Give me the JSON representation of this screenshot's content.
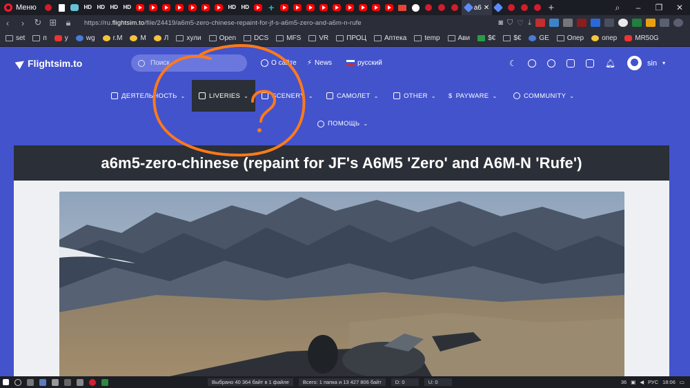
{
  "browser": {
    "menu_label": "Меню",
    "active_tab_title": "a6",
    "address_url_prefix": "https://ru.",
    "address_url_domain": "flightsim.to",
    "address_url_path": "/file/24419/a6m5-zero-chinese-repaint-for-jf-s-a6m5-zero-and-a6m-n-rufe",
    "hd_tab_label": "HD",
    "bookmarks": [
      "set",
      "п",
      "у",
      "wg",
      "r.M",
      "М",
      "Л",
      "хули",
      "Open",
      "DCS",
      "MFS",
      "VR",
      "ПРОЦ",
      "Аптека",
      "temp",
      "Ави",
      "$€",
      "$€",
      "GE",
      "Опер",
      "опер",
      "MR50G"
    ],
    "colors": {
      "tabbar": "#1b1d24",
      "toolbar": "#2b2e39",
      "opera_red": "#ff1b2d"
    }
  },
  "site": {
    "logo_text": "Flightsim.to",
    "search_placeholder": "Поиск",
    "about_label": "О сайте",
    "news_label": "News",
    "language_label": "русский",
    "user_name": "sin",
    "colors": {
      "primary": "#4353cc",
      "dark_band": "#2b2f37",
      "content_bg": "#eef0f4"
    }
  },
  "nav": {
    "items": [
      "ДЕЯТЕЛЬНОСТЬ",
      "LIVERIES",
      "SCENERY",
      "САМОЛЕТ",
      "OTHER",
      "PAYWARE",
      "COMMUNITY"
    ],
    "active": "LIVERIES",
    "help_label": "ПОМОЩЬ"
  },
  "page": {
    "title": "a6m5-zero-chinese (repaint for JF's A6M5 'Zero' and A6M-N 'Rufe')"
  },
  "taskbar": {
    "status_selected": "Выбрано 40 364 байт в 1 файле",
    "status_total": "Всего: 1 папка и 13 427 806 байт",
    "d_label": "D: 0",
    "u_label": "U: 0",
    "tray_num": "36",
    "lang": "РУС",
    "time": "18:06"
  },
  "annotation": {
    "symbol": "?",
    "color": "#ff7a1a"
  }
}
